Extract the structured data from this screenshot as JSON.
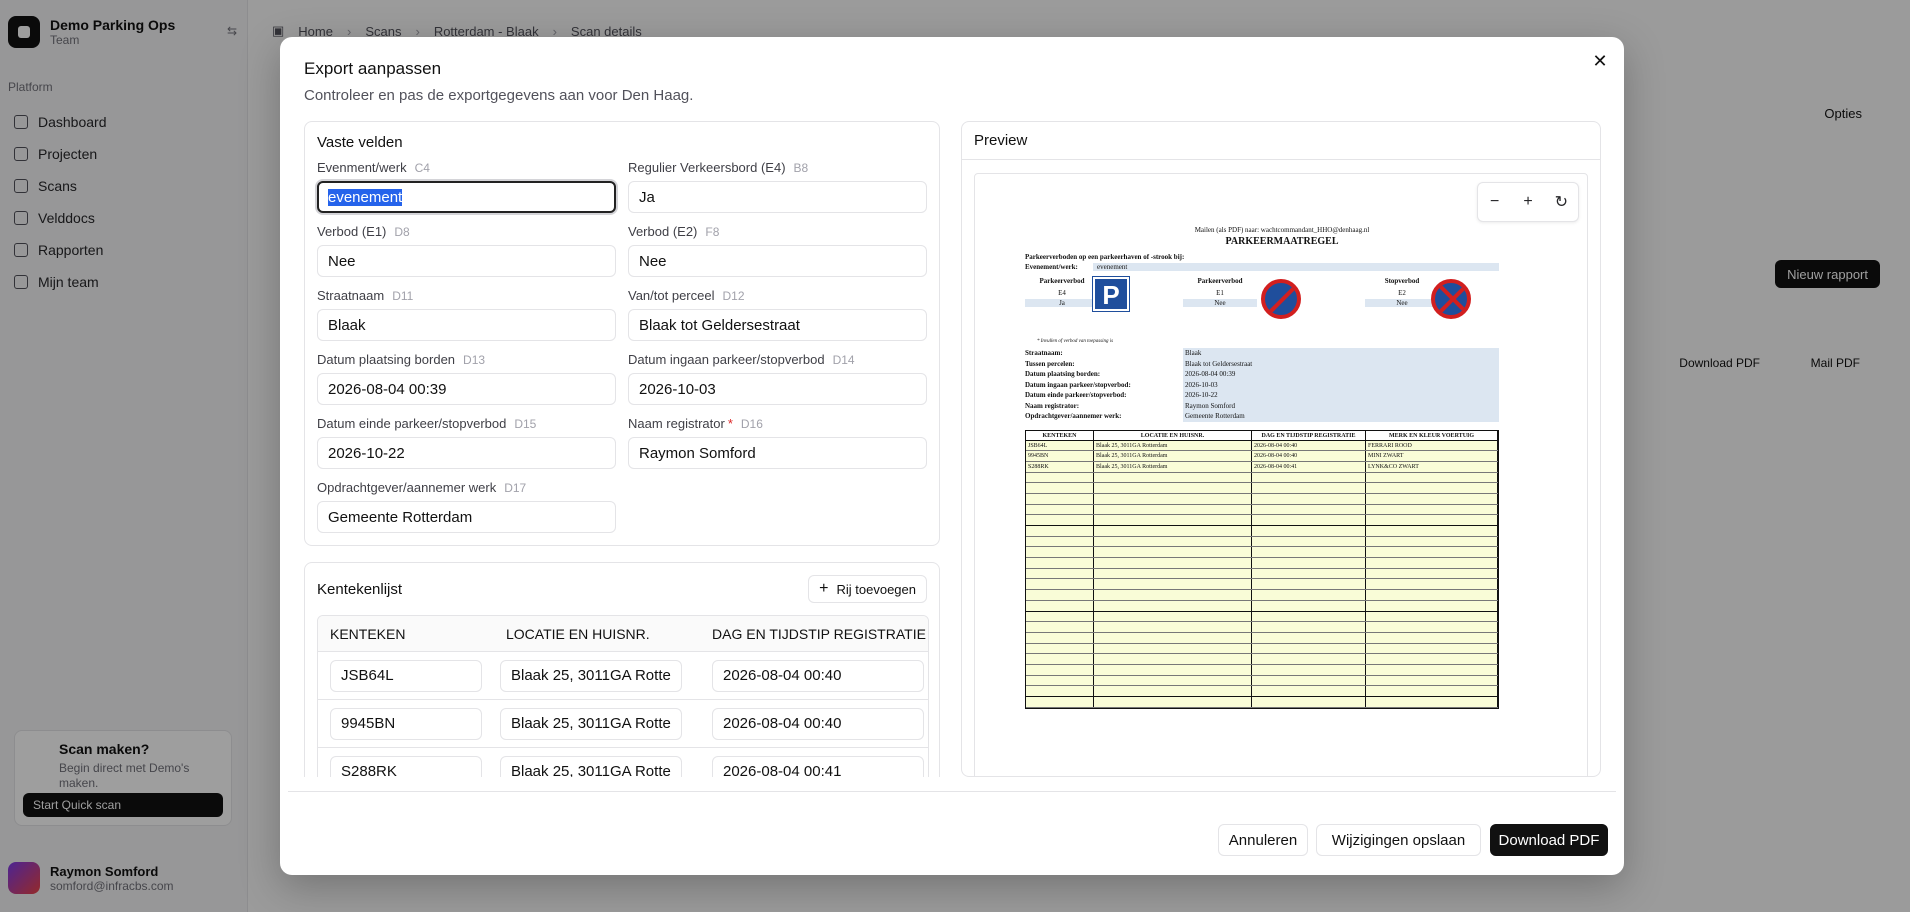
{
  "app": {
    "org_name": "Demo Parking Ops",
    "org_sub": "Team",
    "group_label": "Platform",
    "nav": [
      {
        "label": "Dashboard"
      },
      {
        "label": "Projecten"
      },
      {
        "label": "Scans"
      },
      {
        "label": "Velddocs"
      },
      {
        "label": "Rapporten"
      },
      {
        "label": "Mijn team"
      }
    ],
    "breadcrumbs": [
      "Home",
      "Scans",
      "Rotterdam - Blaak",
      "Scan details"
    ],
    "options_label": "Opties",
    "new_report_label": "Nieuw rapport",
    "download_pdf_label": "Download PDF",
    "mail_pdf_label": "Mail PDF",
    "cta": {
      "title": "Scan maken?",
      "desc": "Begin direct met Demo's maken.",
      "button": "Start Quick scan"
    },
    "user": {
      "name": "Raymon Somford",
      "email": "somford@infracbs.com"
    }
  },
  "modal": {
    "title": "Export aanpassen",
    "description": "Controleer en pas de exportgegevens aan voor Den Haag.",
    "close_icon": "close-icon",
    "fixed_fields": {
      "title": "Vaste velden",
      "fields": [
        {
          "label": "Evenment/werk",
          "cell": "C4",
          "value": "evenement",
          "required": false
        },
        {
          "label": "Regulier Verkeersbord (E4)",
          "cell": "B8",
          "value": "Ja",
          "required": false
        },
        {
          "label": "Verbod (E1)",
          "cell": "D8",
          "value": "Nee",
          "required": false
        },
        {
          "label": "Verbod (E2)",
          "cell": "F8",
          "value": "Nee",
          "required": false
        },
        {
          "label": "Straatnaam",
          "cell": "D11",
          "value": "Blaak",
          "required": false
        },
        {
          "label": "Van/tot perceel",
          "cell": "D12",
          "value": "Blaak tot Geldersestraat",
          "required": false
        },
        {
          "label": "Datum plaatsing borden",
          "cell": "D13",
          "value": "2026-08-04 00:39",
          "required": false
        },
        {
          "label": "Datum ingaan parkeer/stopverbod",
          "cell": "D14",
          "value": "2026-10-03",
          "required": false
        },
        {
          "label": "Datum einde parkeer/stopverbod",
          "cell": "D15",
          "value": "2026-10-22",
          "required": false
        },
        {
          "label": "Naam registrator",
          "cell": "D16",
          "value": "Raymon Somford",
          "required": true,
          "required_mark": "*"
        },
        {
          "label": "Opdrachtgever/aannemer werk",
          "cell": "D17",
          "value": "Gemeente Rotterdam",
          "required": false
        }
      ]
    },
    "plates": {
      "title": "Kentekenlijst",
      "add_row_label": "Rij toevoegen",
      "columns": [
        "KENTEKEN",
        "LOCATIE EN HUISNR.",
        "DAG EN TIJDSTIP REGISTRATIE"
      ],
      "rows": [
        [
          "JSB64L",
          "Blaak 25, 3011GA Rotterdam",
          "2026-08-04 00:40"
        ],
        [
          "9945BN",
          "Blaak 25, 3011GA Rotterdam",
          "2026-08-04 00:40"
        ],
        [
          "S288RK",
          "Blaak 25, 3011GA Rotterdam",
          "2026-08-04 00:41"
        ]
      ]
    },
    "preview": {
      "title": "Preview",
      "zoom_controls": [
        "−",
        "+",
        "↻"
      ],
      "document": {
        "mail_line": "Mailen (als PDF) naar: wachtcommandant_HHO@denhaag.nl",
        "title": "PARKEERMAATREGEL",
        "intro": "Parkeerverboden op een parkeerhaven of -strook bij:",
        "event_label": "Evenement/werk:",
        "event_value": "evenement",
        "signs": [
          {
            "name": "Parkeerverbod",
            "code": "E4",
            "value": "Ja"
          },
          {
            "name": "Parkeerverbod",
            "code": "E1",
            "value": "Nee"
          },
          {
            "name": "Stopverbod",
            "code": "E2",
            "value": "Nee"
          }
        ],
        "sign_p_glyph": "P",
        "note": "* Invullen of verbod van toepassing is",
        "info": [
          {
            "k": "Straatnaam:",
            "v": "Blaak"
          },
          {
            "k": "Tussen percelen:",
            "v": "Blaak tot Geldersestraat"
          },
          {
            "k": "Datum plaatsing borden:",
            "v": "2026-08-04 00:39"
          },
          {
            "k": "Datum ingaan parkeer/stopverbod:",
            "v": "2026-10-03"
          },
          {
            "k": "Datum einde parkeer/stopverbod:",
            "v": "2026-10-22"
          },
          {
            "k": "Naam registrator:",
            "v": "Raymon Somford"
          },
          {
            "k": "Opdrachtgever/aannemer werk:",
            "v": "Gemeente Rotterdam"
          }
        ],
        "table_columns": [
          "KENTEKEN",
          "LOCATIE EN HUISNR.",
          "DAG EN TIJDSTIP REGISTRATIE",
          "MERK EN KLEUR VOERTUIG"
        ],
        "table_rows": [
          [
            "JSB64L",
            "Blaak 25, 3011GA Rotterdam",
            "2026-08-04 00:40",
            "FERRARI ROOD"
          ],
          [
            "9945BN",
            "Blaak 25, 3011GA Rotterdam",
            "2026-08-04 00:40",
            "MINI ZWART"
          ],
          [
            "S288RK",
            "Blaak 25, 3011GA Rotterdam",
            "2026-08-04 00:41",
            "LYNK&CO ZWART"
          ]
        ],
        "empty_rows": 22
      }
    },
    "footer": {
      "cancel_label": "Annuleren",
      "save_label": "Wijzigingen opslaan",
      "download_label": "Download PDF"
    }
  }
}
